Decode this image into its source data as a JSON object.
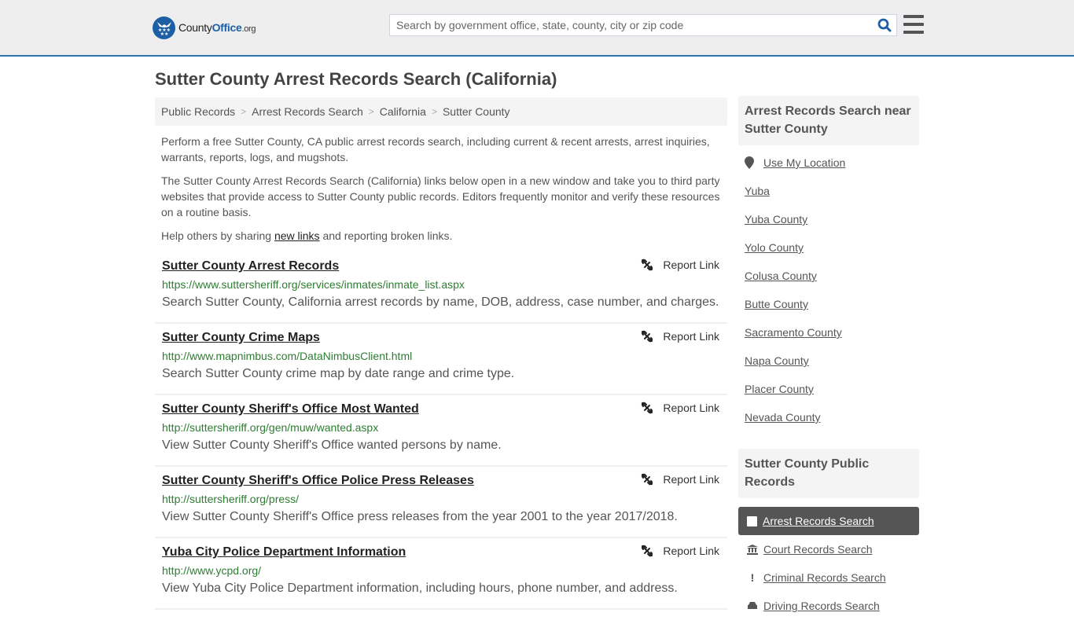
{
  "header": {
    "logo": {
      "name_part1": "County",
      "name_part2": "Office",
      "tld": ".org"
    },
    "search": {
      "placeholder": "Search by government office, state, county, city or zip code",
      "value": ""
    }
  },
  "page": {
    "title": "Sutter County Arrest Records Search (California)"
  },
  "breadcrumb": [
    {
      "label": "Public Records"
    },
    {
      "label": "Arrest Records Search"
    },
    {
      "label": "California"
    },
    {
      "label": "Sutter County"
    }
  ],
  "intro": {
    "p1": "Perform a free Sutter County, CA public arrest records search, including current & recent arrests, arrest inquiries, warrants, reports, logs, and mugshots.",
    "p2": "The Sutter County Arrest Records Search (California) links below open in a new window and take you to third party websites that provide access to Sutter County public records. Editors frequently monitor and verify these resources on a routine basis.",
    "p3_before": "Help others by sharing ",
    "p3_link": "new links",
    "p3_after": " and reporting broken links."
  },
  "report_label": "Report Link",
  "results": [
    {
      "title": "Sutter County Arrest Records",
      "url": "https://www.suttersheriff.org/services/inmates/inmate_list.aspx",
      "description": "Search Sutter County, California arrest records by name, DOB, address, case number, and charges."
    },
    {
      "title": "Sutter County Crime Maps",
      "url": "http://www.mapnimbus.com/DataNimbusClient.html",
      "description": "Search Sutter County crime map by date range and crime type."
    },
    {
      "title": "Sutter County Sheriff's Office Most Wanted",
      "url": "http://suttersheriff.org/gen/muw/wanted.aspx",
      "description": "View Sutter County Sheriff's Office wanted persons by name."
    },
    {
      "title": "Sutter County Sheriff's Office Police Press Releases",
      "url": "http://suttersheriff.org/press/",
      "description": "View Sutter County Sheriff's Office press releases from the year 2001 to the year 2017/2018."
    },
    {
      "title": "Yuba City Police Department Information",
      "url": "http://www.ycpd.org/",
      "description": "View Yuba City Police Department information, including hours, phone number, and address."
    }
  ],
  "sidebar": {
    "nearby_heading": "Arrest Records Search near Sutter County",
    "use_location": "Use My Location",
    "nearby": [
      "Yuba",
      "Yuba County",
      "Yolo County",
      "Colusa County",
      "Butte County",
      "Sacramento County",
      "Napa County",
      "Placer County",
      "Nevada County"
    ],
    "public_records_heading": "Sutter County Public Records",
    "public_records": [
      {
        "label": "Arrest Records Search",
        "icon": "square-icon",
        "active": true
      },
      {
        "label": "Court Records Search",
        "icon": "courthouse-icon",
        "active": false
      },
      {
        "label": "Criminal Records Search",
        "icon": "exclamation-icon",
        "active": false
      },
      {
        "label": "Driving Records Search",
        "icon": "car-icon",
        "active": false
      }
    ]
  },
  "colors": {
    "accent_blue": "#2f73ad",
    "url_green": "#2e7d32",
    "active_bg": "#555555"
  }
}
